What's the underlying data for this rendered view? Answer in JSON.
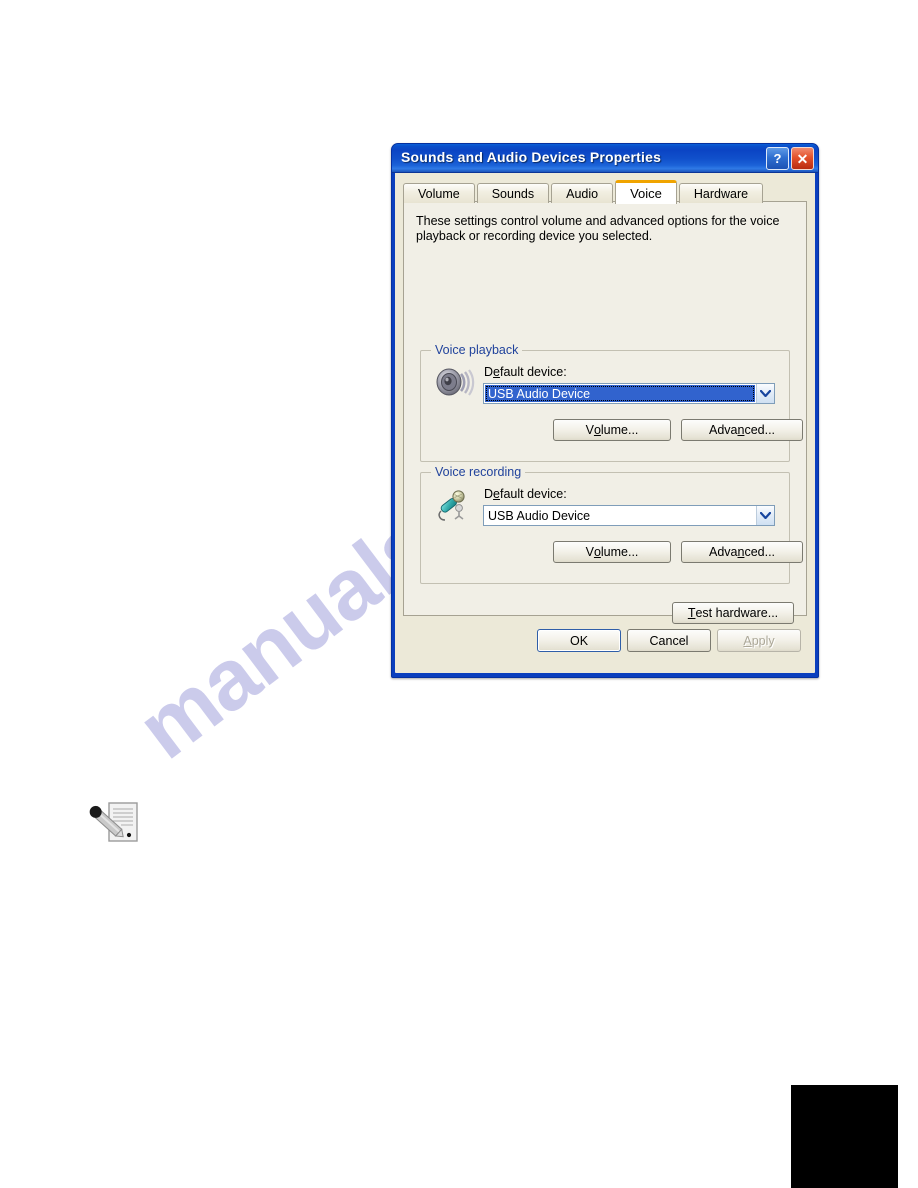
{
  "page": {
    "watermark_text": "manualshive.com",
    "note_icon": "pencil-and-paper-note-icon",
    "black_box": ""
  },
  "dialog": {
    "title": "Sounds and Audio Devices Properties",
    "titlebar_buttons": [
      {
        "name": "help-button",
        "glyph": "?"
      },
      {
        "name": "close-button",
        "glyph": "✕"
      }
    ],
    "accent_color": "#0a4fca",
    "active_tab_accent": "#f0a400",
    "tabs": [
      {
        "label": "Volume",
        "active": false
      },
      {
        "label": "Sounds",
        "active": false
      },
      {
        "label": "Audio",
        "active": false
      },
      {
        "label": "Voice",
        "active": true
      },
      {
        "label": "Hardware",
        "active": false
      }
    ],
    "description": "These settings control volume and advanced options for the voice playback or recording device you selected.",
    "voice_playback": {
      "group_label": "Voice playback",
      "icon": "speaker-icon",
      "device_label_prefix": "D",
      "device_label_accel": "e",
      "device_label_suffix": "fault device:",
      "device_value": "USB Audio Device",
      "device_selected": true,
      "volume_button": {
        "prefix": "V",
        "accel": "o",
        "suffix": "lume..."
      },
      "advanced_button": {
        "prefix": "Adva",
        "accel": "n",
        "suffix": "ced..."
      }
    },
    "voice_recording": {
      "group_label": "Voice recording",
      "icon": "microphone-icon",
      "device_label_prefix": "D",
      "device_label_accel": "e",
      "device_label_suffix": "fault device:",
      "device_value": "USB Audio Device",
      "device_selected": false,
      "volume_button": {
        "prefix": "V",
        "accel": "o",
        "suffix": "lume..."
      },
      "advanced_button": {
        "prefix": "Adva",
        "accel": "n",
        "suffix": "ced..."
      }
    },
    "test_hardware_button": {
      "prefix": "",
      "accel": "T",
      "suffix": "est hardware..."
    },
    "footer": {
      "ok": {
        "label": "OK",
        "default": true,
        "disabled": false
      },
      "cancel": {
        "label": "Cancel",
        "default": false,
        "disabled": false
      },
      "apply": {
        "prefix": "",
        "accel": "A",
        "suffix": "pply",
        "default": false,
        "disabled": true
      }
    }
  }
}
